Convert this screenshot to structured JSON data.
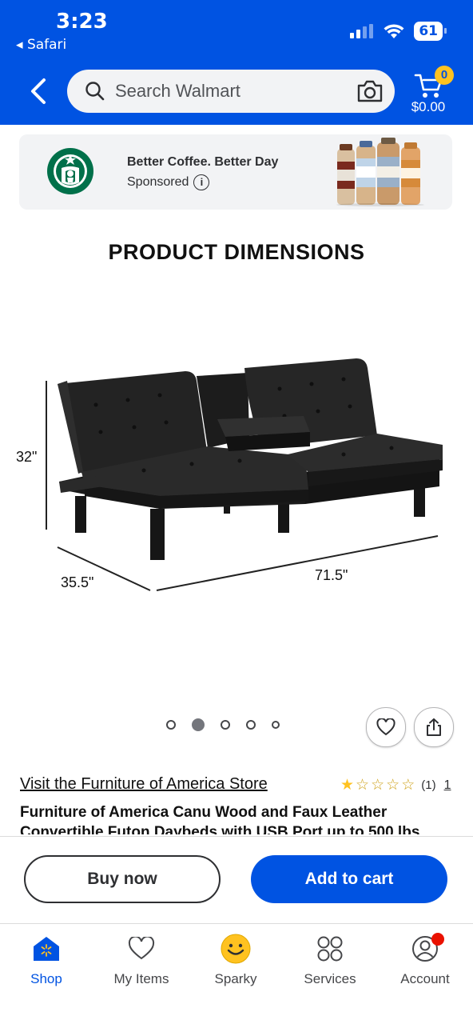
{
  "status_bar": {
    "time": "3:23",
    "back_app": "Safari",
    "battery": "61"
  },
  "header": {
    "search_placeholder": "Search Walmart",
    "cart_count": "0",
    "cart_total": "$0.00"
  },
  "ad": {
    "title": "Better Coffee. Better Day",
    "sponsored_label": "Sponsored",
    "info_icon": "i"
  },
  "product": {
    "image_heading": "PRODUCT DIMENSIONS",
    "dimensions": {
      "height": "32\"",
      "depth": "35.5\"",
      "width": "71.5\""
    },
    "carousel": {
      "total_images": 5,
      "active_index": 1
    },
    "store_link": "Visit the Furniture of America Store",
    "rating_stars": 1,
    "rating_max": 5,
    "rating_count": "(1)",
    "review_link": "1",
    "title": "Furniture of America Canu Wood and Faux Leather Convertible Futon Daybeds with USB Port up to 500 lbs."
  },
  "actions": {
    "buy_now": "Buy now",
    "add_to_cart": "Add to cart"
  },
  "bottom_nav": {
    "items": [
      {
        "label": "Shop",
        "icon": "shop-icon",
        "active": true
      },
      {
        "label": "My Items",
        "icon": "heart-icon"
      },
      {
        "label": "Sparky",
        "icon": "sparky-icon"
      },
      {
        "label": "Services",
        "icon": "services-icon"
      },
      {
        "label": "Account",
        "icon": "account-icon",
        "notification": true
      }
    ]
  },
  "colors": {
    "brand_blue": "#0053e2",
    "spark_yellow": "#ffc220",
    "notification_red": "#ea1100"
  }
}
